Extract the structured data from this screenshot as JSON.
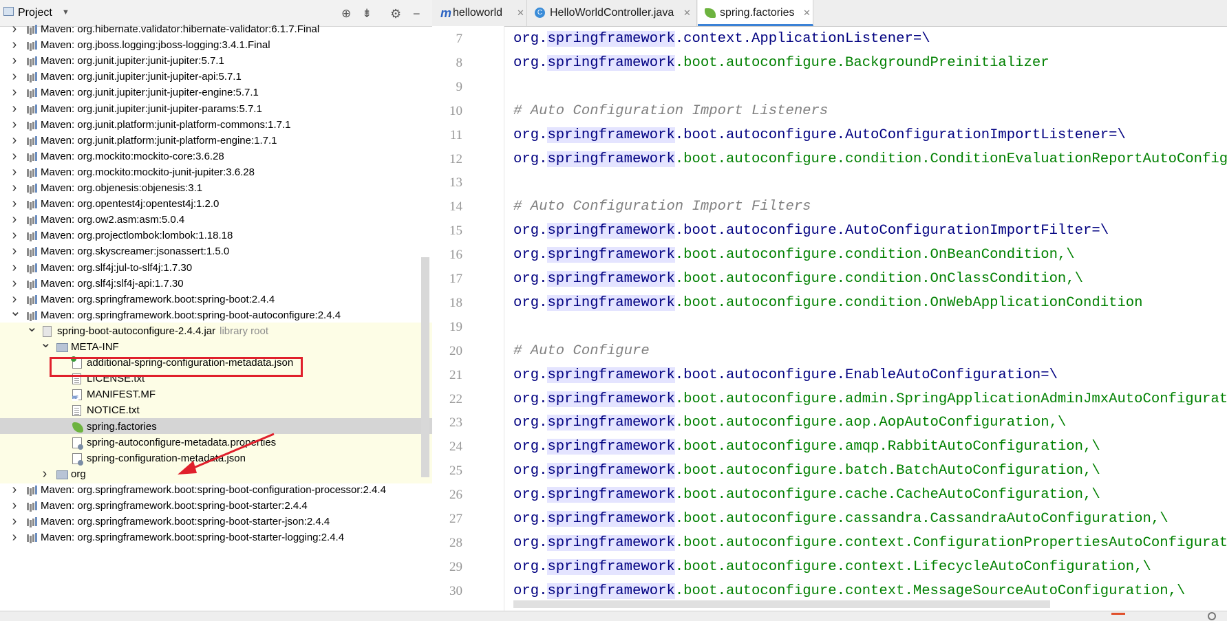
{
  "project_panel": {
    "title": "Project",
    "tree": [
      {
        "label": "Maven: org.hibernate.validator:hibernate-validator:6.1.7.Final",
        "depth": 1,
        "icon": "library",
        "expand": "collapsed"
      },
      {
        "label": "Maven: org.jboss.logging:jboss-logging:3.4.1.Final",
        "depth": 1,
        "icon": "library",
        "expand": "collapsed"
      },
      {
        "label": "Maven: org.junit.jupiter:junit-jupiter:5.7.1",
        "depth": 1,
        "icon": "library",
        "expand": "collapsed"
      },
      {
        "label": "Maven: org.junit.jupiter:junit-jupiter-api:5.7.1",
        "depth": 1,
        "icon": "library",
        "expand": "collapsed"
      },
      {
        "label": "Maven: org.junit.jupiter:junit-jupiter-engine:5.7.1",
        "depth": 1,
        "icon": "library",
        "expand": "collapsed"
      },
      {
        "label": "Maven: org.junit.jupiter:junit-jupiter-params:5.7.1",
        "depth": 1,
        "icon": "library",
        "expand": "collapsed"
      },
      {
        "label": "Maven: org.junit.platform:junit-platform-commons:1.7.1",
        "depth": 1,
        "icon": "library",
        "expand": "collapsed"
      },
      {
        "label": "Maven: org.junit.platform:junit-platform-engine:1.7.1",
        "depth": 1,
        "icon": "library",
        "expand": "collapsed"
      },
      {
        "label": "Maven: org.mockito:mockito-core:3.6.28",
        "depth": 1,
        "icon": "library",
        "expand": "collapsed"
      },
      {
        "label": "Maven: org.mockito:mockito-junit-jupiter:3.6.28",
        "depth": 1,
        "icon": "library",
        "expand": "collapsed"
      },
      {
        "label": "Maven: org.objenesis:objenesis:3.1",
        "depth": 1,
        "icon": "library",
        "expand": "collapsed"
      },
      {
        "label": "Maven: org.opentest4j:opentest4j:1.2.0",
        "depth": 1,
        "icon": "library",
        "expand": "collapsed"
      },
      {
        "label": "Maven: org.ow2.asm:asm:5.0.4",
        "depth": 1,
        "icon": "library",
        "expand": "collapsed"
      },
      {
        "label": "Maven: org.projectlombok:lombok:1.18.18",
        "depth": 1,
        "icon": "library",
        "expand": "collapsed"
      },
      {
        "label": "Maven: org.skyscreamer:jsonassert:1.5.0",
        "depth": 1,
        "icon": "library",
        "expand": "collapsed"
      },
      {
        "label": "Maven: org.slf4j:jul-to-slf4j:1.7.30",
        "depth": 1,
        "icon": "library",
        "expand": "collapsed"
      },
      {
        "label": "Maven: org.slf4j:slf4j-api:1.7.30",
        "depth": 1,
        "icon": "library",
        "expand": "collapsed"
      },
      {
        "label": "Maven: org.springframework.boot:spring-boot:2.4.4",
        "depth": 1,
        "icon": "library",
        "expand": "collapsed"
      },
      {
        "label": "Maven: org.springframework.boot:spring-boot-autoconfigure:2.4.4",
        "depth": 1,
        "icon": "library",
        "expand": "expanded"
      },
      {
        "label": "spring-boot-autoconfigure-2.4.4.jar",
        "sub": "library root",
        "depth": 2,
        "icon": "jar",
        "expand": "expanded",
        "style": "yellow"
      },
      {
        "label": "META-INF",
        "depth": 3,
        "icon": "folder",
        "expand": "expanded",
        "style": "yellow"
      },
      {
        "label": "additional-spring-configuration-metadata.json",
        "depth": 4,
        "icon": "json",
        "expand": "none",
        "style": "yellow"
      },
      {
        "label": "LICENSE.txt",
        "depth": 4,
        "icon": "text",
        "expand": "none",
        "style": "yellow"
      },
      {
        "label": "MANIFEST.MF",
        "depth": 4,
        "icon": "manifest",
        "expand": "none",
        "style": "yellow"
      },
      {
        "label": "NOTICE.txt",
        "depth": 4,
        "icon": "text",
        "expand": "none",
        "style": "yellow"
      },
      {
        "label": "spring.factories",
        "depth": 4,
        "icon": "spring",
        "expand": "none",
        "style": "selected"
      },
      {
        "label": "spring-autoconfigure-metadata.properties",
        "depth": 4,
        "icon": "properties",
        "expand": "none",
        "style": "yellow"
      },
      {
        "label": "spring-configuration-metadata.json",
        "depth": 4,
        "icon": "properties",
        "expand": "none",
        "style": "yellow"
      },
      {
        "label": "org",
        "depth": 3,
        "icon": "folder",
        "expand": "collapsed",
        "style": "yellow"
      },
      {
        "label": "Maven: org.springframework.boot:spring-boot-configuration-processor:2.4.4",
        "depth": 1,
        "icon": "library",
        "expand": "collapsed"
      },
      {
        "label": "Maven: org.springframework.boot:spring-boot-starter:2.4.4",
        "depth": 1,
        "icon": "library",
        "expand": "collapsed"
      },
      {
        "label": "Maven: org.springframework.boot:spring-boot-starter-json:2.4.4",
        "depth": 1,
        "icon": "library",
        "expand": "collapsed"
      },
      {
        "label": "Maven: org.springframework.boot:spring-boot-starter-logging:2.4.4",
        "depth": 1,
        "icon": "library",
        "expand": "collapsed"
      }
    ]
  },
  "editor": {
    "tabs": [
      {
        "label": "helloworld",
        "icon": "maven-module-icon",
        "active": false
      },
      {
        "label": "HelloWorldController.java",
        "icon": "java-class-icon",
        "active": false
      },
      {
        "label": "spring.factories",
        "icon": "spring-icon",
        "active": true
      }
    ],
    "lines": [
      {
        "n": "7",
        "kind": "code",
        "rest": "context.ApplicationListener=\\"
      },
      {
        "n": "8",
        "kind": "code",
        "rest": "boot.autoconfigure.BackgroundPreinitializer"
      },
      {
        "n": "9",
        "kind": "blank",
        "rest": ""
      },
      {
        "n": "10",
        "kind": "comment",
        "rest": "# Auto Configuration Import Listeners"
      },
      {
        "n": "11",
        "kind": "code",
        "rest": "boot.autoconfigure.AutoConfigurationImportListener=\\"
      },
      {
        "n": "12",
        "kind": "code",
        "rest": "boot.autoconfigure.condition.ConditionEvaluationReportAutoConfigurationImportListener"
      },
      {
        "n": "13",
        "kind": "blank",
        "rest": ""
      },
      {
        "n": "14",
        "kind": "comment",
        "rest": "# Auto Configuration Import Filters"
      },
      {
        "n": "15",
        "kind": "code",
        "rest": "boot.autoconfigure.AutoConfigurationImportFilter=\\"
      },
      {
        "n": "16",
        "kind": "code",
        "rest": "boot.autoconfigure.condition.OnBeanCondition,\\"
      },
      {
        "n": "17",
        "kind": "code",
        "rest": "boot.autoconfigure.condition.OnClassCondition,\\"
      },
      {
        "n": "18",
        "kind": "code",
        "rest": "boot.autoconfigure.condition.OnWebApplicationCondition"
      },
      {
        "n": "19",
        "kind": "blank",
        "rest": ""
      },
      {
        "n": "20",
        "kind": "comment",
        "rest": "# Auto Configure"
      },
      {
        "n": "21",
        "kind": "code",
        "rest": "boot.autoconfigure.EnableAutoConfiguration=\\"
      },
      {
        "n": "22",
        "kind": "code",
        "rest": "boot.autoconfigure.admin.SpringApplicationAdminJmxAutoConfiguration,\\"
      },
      {
        "n": "23",
        "kind": "code",
        "rest": "boot.autoconfigure.aop.AopAutoConfiguration,\\"
      },
      {
        "n": "24",
        "kind": "code",
        "rest": "boot.autoconfigure.amqp.RabbitAutoConfiguration,\\"
      },
      {
        "n": "25",
        "kind": "code",
        "rest": "boot.autoconfigure.batch.BatchAutoConfiguration,\\"
      },
      {
        "n": "26",
        "kind": "code",
        "rest": "boot.autoconfigure.cache.CacheAutoConfiguration,\\"
      },
      {
        "n": "27",
        "kind": "code",
        "rest": "boot.autoconfigure.cassandra.CassandraAutoConfiguration,\\"
      },
      {
        "n": "28",
        "kind": "code",
        "rest": "boot.autoconfigure.context.ConfigurationPropertiesAutoConfiguration,\\"
      },
      {
        "n": "29",
        "kind": "code",
        "rest": "boot.autoconfigure.context.LifecycleAutoConfiguration,\\"
      },
      {
        "n": "30",
        "kind": "code",
        "rest": "boot.autoconfigure.context.MessageSourceAutoConfiguration,\\"
      }
    ],
    "prefix_org": "org.",
    "prefix_sf": "springframework"
  },
  "colors": {
    "code_blue": "#000080",
    "code_green": "#008000",
    "comment_gray": "#808080",
    "highlight_red": "#e0202c",
    "library_root_yellow": "#fdfde6",
    "selection_gray": "#d5d5d5"
  }
}
